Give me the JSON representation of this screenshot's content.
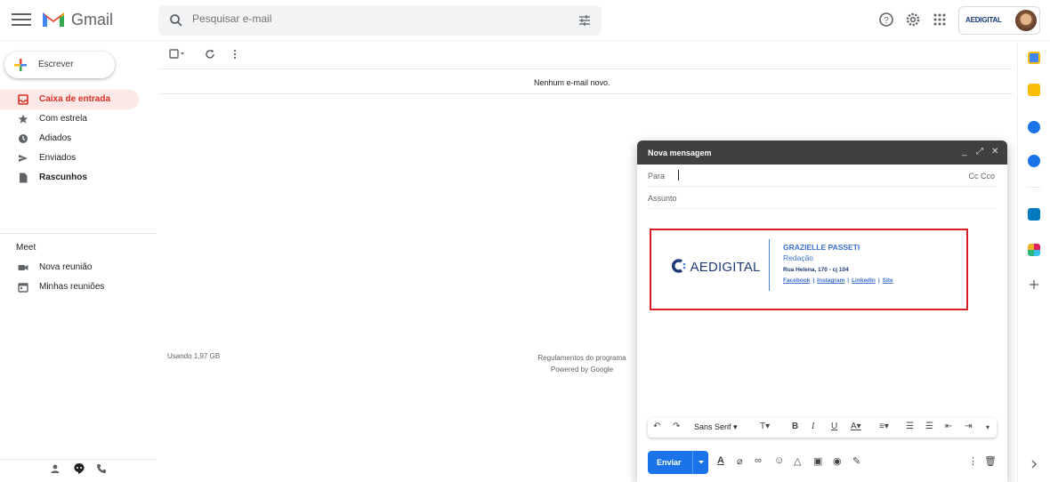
{
  "app": {
    "name": "Gmail"
  },
  "search": {
    "placeholder": "Pesquisar e-mail"
  },
  "account": {
    "logo_text": "AEDIGITAL"
  },
  "compose_button": {
    "label": "Escrever"
  },
  "sidebar": {
    "items": [
      {
        "label": "Caixa de entrada",
        "icon": "inbox-icon",
        "active": true
      },
      {
        "label": "Com estrela",
        "icon": "star-icon"
      },
      {
        "label": "Adiados",
        "icon": "clock-icon"
      },
      {
        "label": "Enviados",
        "icon": "send-icon"
      },
      {
        "label": "Rascunhos",
        "icon": "draft-icon",
        "bold": true
      }
    ],
    "meet": {
      "title": "Meet",
      "items": [
        {
          "label": "Nova reunião",
          "icon": "video-icon"
        },
        {
          "label": "Minhas reuniões",
          "icon": "calendar-icon"
        }
      ]
    }
  },
  "main": {
    "empty_message": "Nenhum e-mail novo.",
    "storage": "Usando 1,97 GB",
    "terms": "Regulamentos do programa",
    "powered": "Powered by Google"
  },
  "compose": {
    "title": "Nova mensagem",
    "to_label": "Para",
    "cc_label": "Cc Cco",
    "subject_placeholder": "Assunto",
    "signature": {
      "logo": "AEDIGITAL",
      "name": "GRAZIELLE PASSETI",
      "role": "Redação",
      "address": "Rua Helena, 170 - cj 104",
      "links": [
        "Facebook",
        "Instagram",
        "LinkedIn",
        "Site"
      ]
    },
    "font": "Sans Serif",
    "send_label": "Enviar"
  },
  "colors": {
    "accent": "#1a73e8",
    "active_bg": "#fce8e6",
    "active_text": "#d93025",
    "frame": "#d61c24"
  }
}
